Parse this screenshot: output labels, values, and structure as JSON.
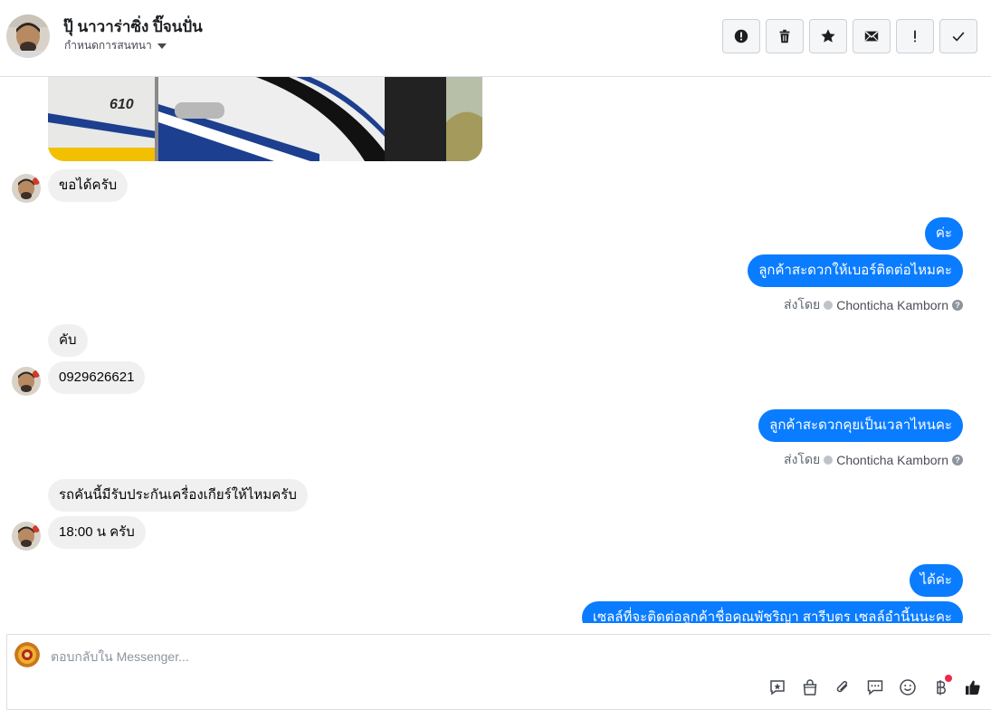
{
  "header": {
    "contact_name": "ปุ๊ นาวาร่าซิ่ง ปิ๊จนปั่น",
    "assign_label": "กำหนดการสนทนา",
    "actions": [
      {
        "name": "mark-spam-button",
        "icon": "alert-circle-icon"
      },
      {
        "name": "delete-button",
        "icon": "trash-icon"
      },
      {
        "name": "star-button",
        "icon": "star-icon"
      },
      {
        "name": "mark-unread-button",
        "icon": "envelope-icon"
      },
      {
        "name": "follow-up-button",
        "icon": "exclamation-icon"
      },
      {
        "name": "mark-done-button",
        "icon": "check-icon"
      }
    ]
  },
  "messages": {
    "m1": "ขอได้ครับ",
    "m2": "ค่ะ",
    "m3": "ลูกค้าสะดวกให้เบอร์ติดต่อไหมคะ",
    "m4": "คับ",
    "m5": "0929626621",
    "m6": "ลูกค้าสะดวกคุยเป็นเวลาไหนคะ",
    "m7": "รถคันนี้มีรับประกันเครื่องเกียร์ให้ไหมครับ",
    "m8": "18:00 น ครับ",
    "m9": "ได้ค่ะ",
    "m10": "เซลล์ที่จะติดต่อลูกค้าชื่อคุณพัชริญา สารีบตร เซลล์อำนี้นนะคะ"
  },
  "sent_by": {
    "prefix": "ส่งโดย",
    "agent": "Chonticha Kamborn"
  },
  "photo": {
    "model_text": "610"
  },
  "colors": {
    "outgoing": "#0a7cff",
    "incoming": "#f0f0f0",
    "notification": "#f02849"
  },
  "composer": {
    "placeholder": "ตอบกลับใน Messenger...",
    "tools": [
      "saved-reply-icon",
      "shop-bag-icon",
      "paperclip-icon",
      "chat-bubble-icon",
      "smiley-icon",
      "baht-icon",
      "thumbs-up-icon"
    ]
  }
}
